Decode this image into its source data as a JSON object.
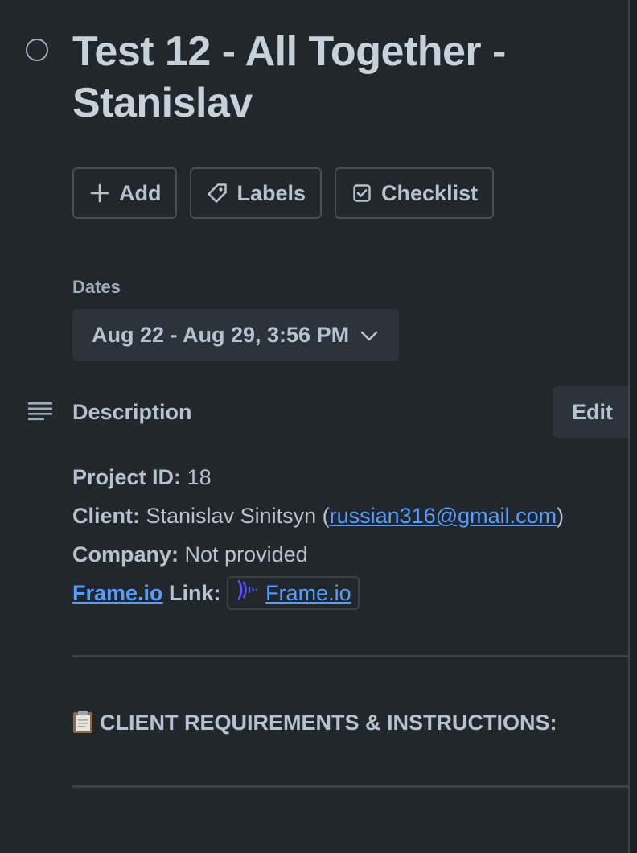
{
  "card": {
    "title": "Test 12 - All Together - Stanislav"
  },
  "actions": [
    {
      "label": "Add",
      "icon": "plus-icon"
    },
    {
      "label": "Labels",
      "icon": "label-tag-icon"
    },
    {
      "label": "Checklist",
      "icon": "checklist-icon"
    }
  ],
  "dates": {
    "label": "Dates",
    "value": "Aug 22 - Aug 29, 3:56 PM"
  },
  "description": {
    "heading": "Description",
    "edit_label": "Edit",
    "project_id_label": "Project ID:",
    "project_id_value": "18",
    "client_label": "Client:",
    "client_name": "Stanislav Sinitsyn (",
    "client_email": "russian316@gmail.com",
    "client_close": ")",
    "company_label": "Company:",
    "company_value": "Not provided",
    "frameio_prefix": "Frame.io",
    "frameio_link_label": " Link:",
    "frameio_smart_link": "Frame.io",
    "requirements_heading": "CLIENT REQUIREMENTS & INSTRUCTIONS:"
  },
  "colors": {
    "background": "#22272b",
    "text": "#b6c2cf",
    "link": "#579dff",
    "frameio_brand": "#5b53ff"
  }
}
